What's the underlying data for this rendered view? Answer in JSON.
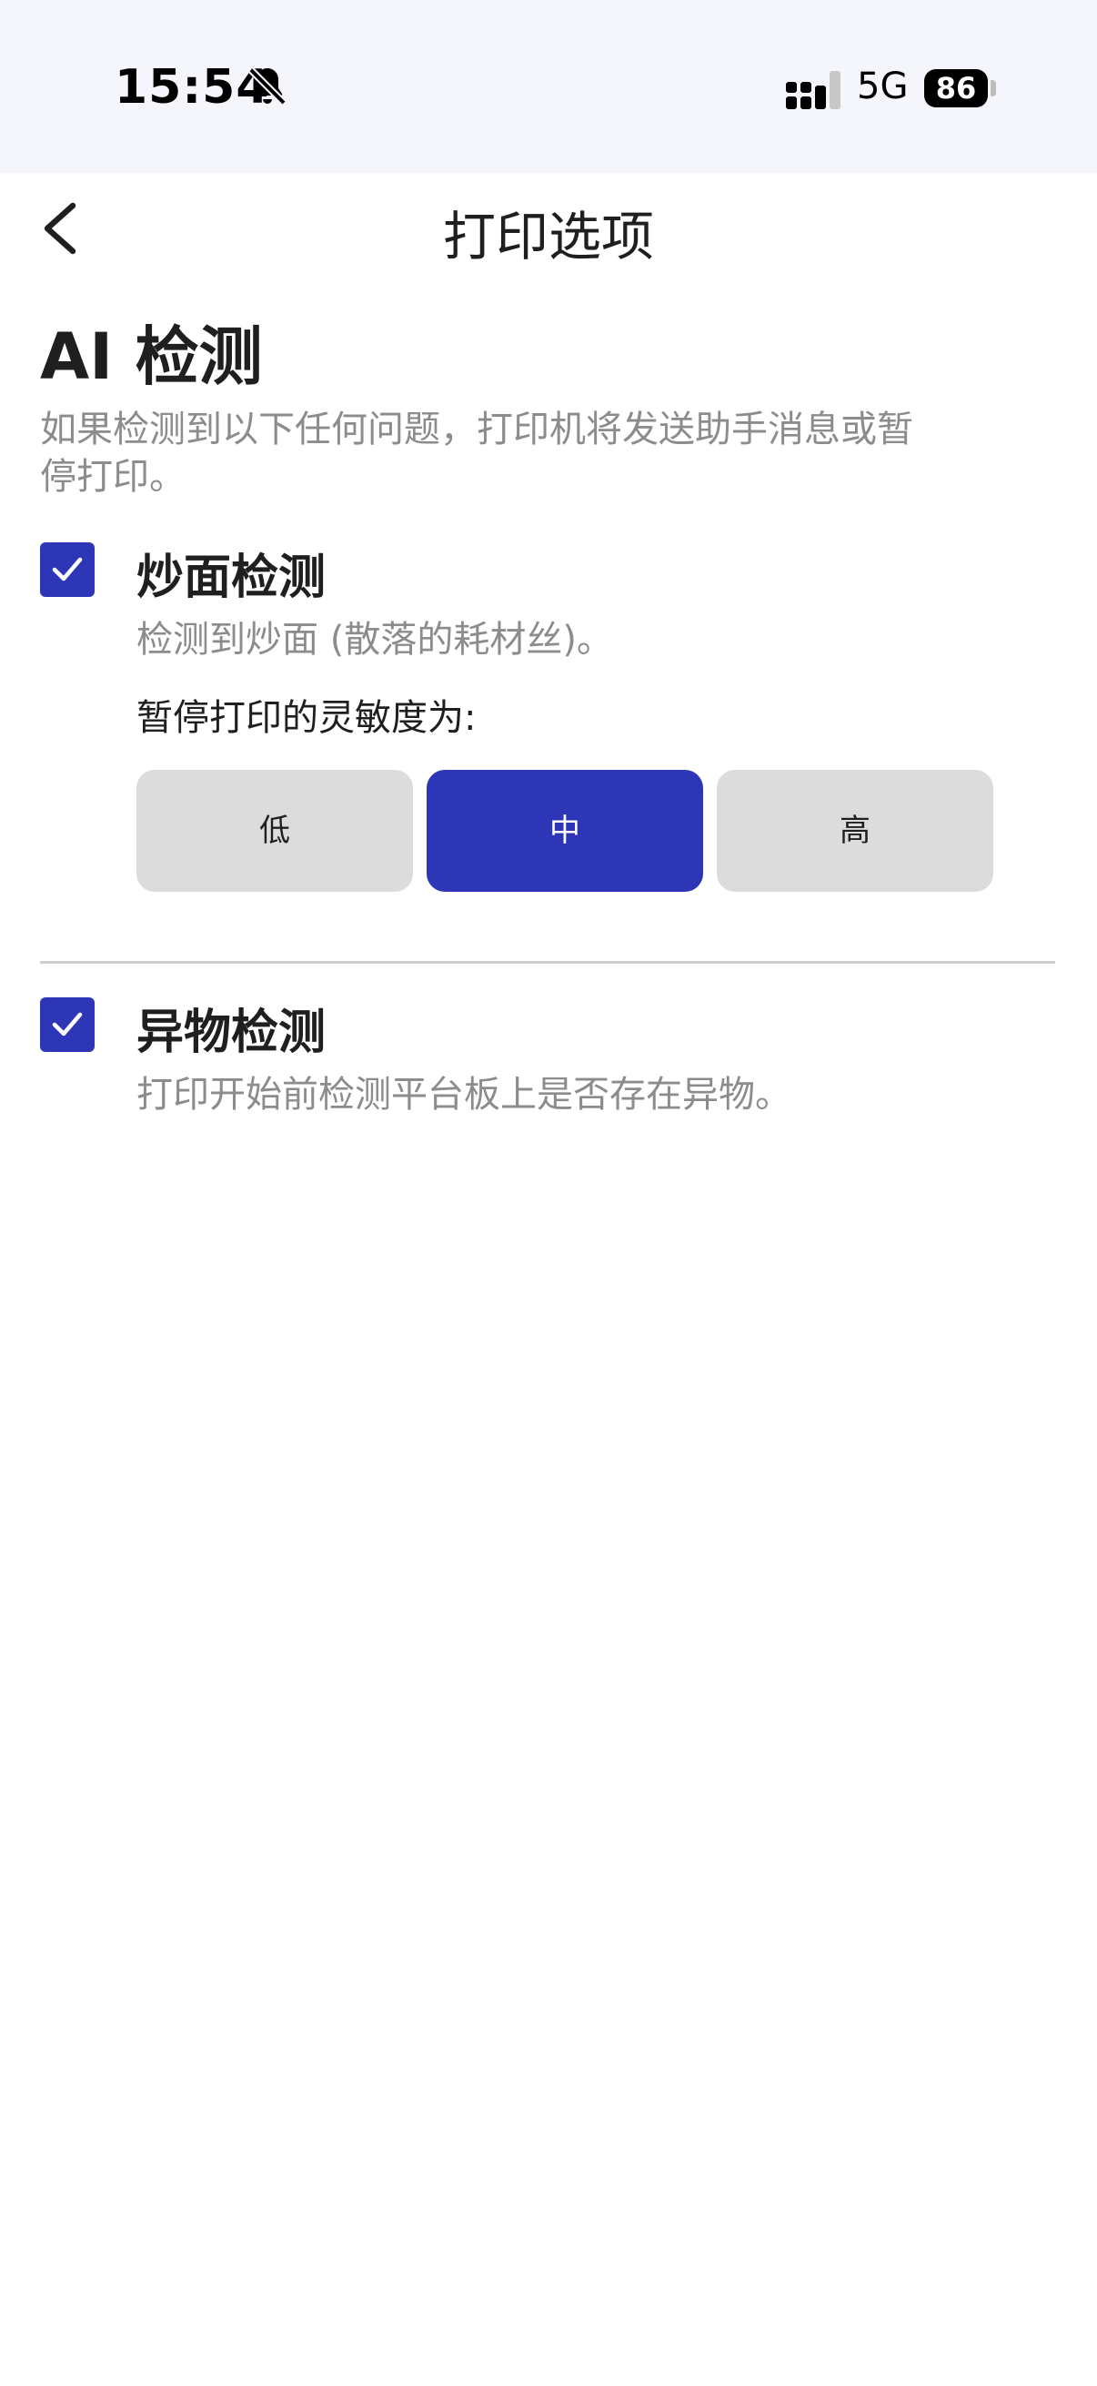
{
  "status_bar": {
    "time": "15:54",
    "network": "5G",
    "battery": "86",
    "icons": [
      "bell-muted-icon",
      "signal-icon",
      "battery-icon"
    ]
  },
  "nav": {
    "title": "打印选项",
    "back_icon": "chevron-left-icon"
  },
  "section": {
    "title": "AI 检测",
    "description": "如果检测到以下任何问题，打印机将发送助手消息或暂停打印。"
  },
  "options": [
    {
      "title": "炒面检测",
      "description": "检测到炒面 (散落的耗材丝)。",
      "checked": true,
      "sensitivity_label": "暂停打印的灵敏度为:",
      "sensitivity_levels": [
        "低",
        "中",
        "高"
      ],
      "sensitivity_selected": "中"
    },
    {
      "title": "异物检测",
      "description": "打印开始前检测平台板上是否存在异物。",
      "checked": true
    }
  ],
  "colors": {
    "accent": "#2e36b8",
    "unselected_button": "#dcdcdc",
    "secondary_text": "#8c8c8c",
    "header_bg": "#f5f6fb"
  }
}
